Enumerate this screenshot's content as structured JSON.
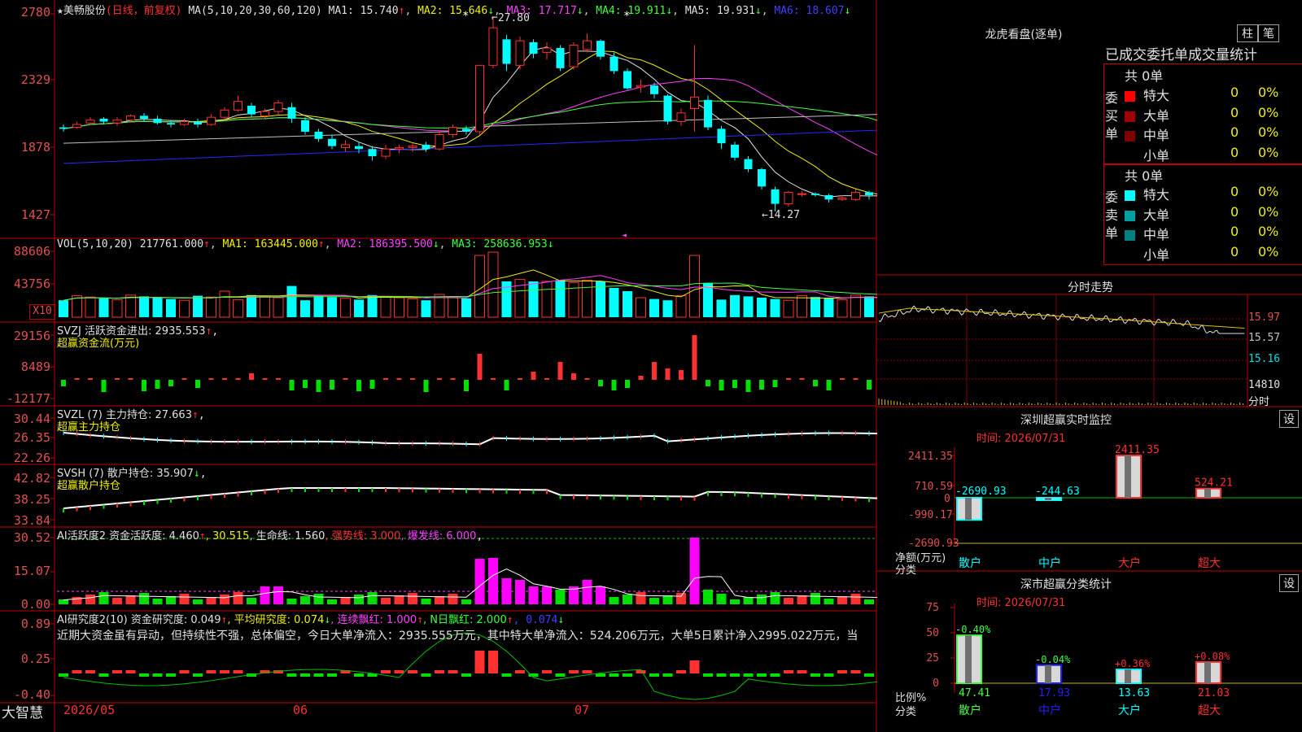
{
  "colors": {
    "up": "#ff3030",
    "down": "#00ffff",
    "ma1": "#e0e0e0",
    "ma2": "#f0f000",
    "ma3": "#ff40ff",
    "ma4": "#40ff40",
    "ma5": "#c0c0c0",
    "ma6": "#2828ff",
    "grid": "#c00000"
  },
  "main": {
    "stock": "★美畅股份",
    "mode": "(日线，前复权)",
    "ma_label": "MA(5,10,20,30,60,120)",
    "ma1": "MA1: 15.740",
    "ma2": "MA2: 15.646",
    "ma3": "MA3: 17.717",
    "ma4": "MA4: 19.911",
    "ma5": "MA5: 19.931",
    "ma6": "MA6: 18.607",
    "ma1_arrow": "↑",
    "ma2_arrow": "↓",
    "ma3_arrow": "↓",
    "ma4_arrow": "↓",
    "ma5_arrow": "↓",
    "ma6_arrow": "↓",
    "ylabels": [
      "2780",
      "2329",
      "1878",
      "1427"
    ],
    "high_label": "27.80",
    "low_label": "←14.27"
  },
  "vol": {
    "label": "VOL(5,10,20)",
    "v": "217761.000",
    "ma1": "MA1: 163445.000",
    "ma2": "MA2: 186395.500",
    "ma3": "MA3: 258636.953",
    "v_arrow": "↑",
    "ma1_arrow": "↑",
    "ma2_arrow": "↓",
    "ma3_arrow": "↓",
    "ylabels": [
      "88606",
      "43756"
    ],
    "unit": "X10"
  },
  "svzj": {
    "label": "SVZJ  活跃资金进出: 2935.553",
    "arrow": "↑",
    "tail": ",",
    "sub": "超赢资金流(万元)",
    "ylabels": [
      "29156",
      "8489",
      "-12177"
    ]
  },
  "svzl": {
    "label": "SVZL (7) 主力持仓: 27.663",
    "arrow": "↑",
    "tail": ",",
    "sub": "超赢主力持仓",
    "ylabels": [
      "30.44",
      "26.35",
      "22.26"
    ]
  },
  "svsh": {
    "label": "SVSH (7) 散户持仓: 35.907",
    "arrow": "↓",
    "tail": ",",
    "sub": "超赢散户持仓",
    "ylabels": [
      "42.82",
      "38.25",
      "33.84"
    ]
  },
  "ai1": {
    "label": "AI活跃度2 资金活跃度: 4.460",
    "a1": "↑",
    "v2": ", 30.515",
    "v3": ", 生命线: 1.560",
    "v4": ", 强势线: 3.000",
    "v5": ", 爆发线: 6.000",
    "tail": ",",
    "ylabels": [
      "30.52",
      "15.07",
      "0.00"
    ]
  },
  "ai2": {
    "label": "AI研究度2(10) 资金研究度: 0.049",
    "a1": "↑",
    "v2": ", 平均研究度: 0.074",
    "a2": "↓",
    "v3": ", 连续飘红: 1.000",
    "a3": "↑",
    "v4": ", N日飘红: 2.000",
    "a4": "↑",
    "v5": ", 0.074",
    "a5": "↓",
    "text": "近期大资金虽有异动，但持续性不强，总体偏空，今日大单净流入：2935.555万元，其中特大单净流入：524.206万元，大单5日累计净入2995.022万元，当",
    "ylabels": [
      "0.89",
      "0.25",
      "-0.40"
    ]
  },
  "xaxis": {
    "brand": "大智慧",
    "d1": "2026/05",
    "d2": "06",
    "d3": "07"
  },
  "lhb": {
    "title": "龙虎看盘(逐单)",
    "btn1": "柱",
    "btn2": "笔",
    "head": "已成交委托单成交量统计",
    "buy_side": "委买单",
    "sell_side": "委卖单",
    "buy_total": "共 0单",
    "sell_total": "共 0单",
    "buy_rows": [
      {
        "name": "特大",
        "v": "0",
        "p": "0%"
      },
      {
        "name": "大单",
        "v": "0",
        "p": "0%"
      },
      {
        "name": "中单",
        "v": "0",
        "p": "0%"
      },
      {
        "name": "小单",
        "v": "0",
        "p": "0%"
      }
    ],
    "sell_rows": [
      {
        "name": "特大",
        "v": "0",
        "p": "0%"
      },
      {
        "name": "大单",
        "v": "0",
        "p": "0%"
      },
      {
        "name": "中单",
        "v": "0",
        "p": "0%"
      },
      {
        "name": "小单",
        "v": "0",
        "p": "0%"
      }
    ]
  },
  "fs": {
    "title": "分时走势",
    "p1": "15.97",
    "p2": "15.57",
    "p3": "15.16",
    "vol": "14810",
    "unit": "分时"
  },
  "sz": {
    "title": "深圳超赢实时监控",
    "btn": "设",
    "time": "时间: 2026/07/31",
    "ylabels": [
      "2411.35",
      "710.59",
      "0",
      "-990.17",
      "-2690.93"
    ],
    "ylab": "净额(万元)",
    "xlab": "分类",
    "bars": [
      {
        "name": "散户",
        "value": -2690.93,
        "label": "-2690.93"
      },
      {
        "name": "中户",
        "value": -244.63,
        "label": "-244.63"
      },
      {
        "name": "大户",
        "value": 2411.35,
        "label": "2411.35"
      },
      {
        "name": "超大",
        "value": 524.21,
        "label": "524.21"
      }
    ]
  },
  "ss": {
    "title": "深市超赢分类统计",
    "btn": "设",
    "time": "时间: 2026/07/31",
    "ylabels": [
      "75",
      "50",
      "25",
      "0"
    ],
    "ylab": "比例%",
    "xlab": "分类",
    "bars": [
      {
        "name": "散户",
        "value": 47.41,
        "label": "47.41",
        "delta": "-0.40%"
      },
      {
        "name": "中户",
        "value": 17.93,
        "label": "17.93",
        "delta": "-0.04%"
      },
      {
        "name": "大户",
        "value": 13.63,
        "label": "13.63",
        "delta": "+0.36%"
      },
      {
        "name": "超大",
        "value": 21.03,
        "label": "21.03",
        "delta": "+0.08%"
      }
    ]
  },
  "chart_data": {
    "type": "candlestick",
    "title": "美畅股份 日线 前复权",
    "candles": [
      [
        20.1,
        20.0,
        20.3,
        19.8
      ],
      [
        20.1,
        20.3,
        20.5,
        20.0
      ],
      [
        20.4,
        20.6,
        20.8,
        20.3
      ],
      [
        20.7,
        20.5,
        20.8,
        20.3
      ],
      [
        20.4,
        20.6,
        20.8,
        20.2
      ],
      [
        20.6,
        20.9,
        21.0,
        20.5
      ],
      [
        20.9,
        20.7,
        21.1,
        20.5
      ],
      [
        20.7,
        20.4,
        20.9,
        20.3
      ],
      [
        20.4,
        20.3,
        20.6,
        20.1
      ],
      [
        20.3,
        20.5,
        20.7,
        20.2
      ],
      [
        20.5,
        20.3,
        20.7,
        20.1
      ],
      [
        20.3,
        20.8,
        21.0,
        20.2
      ],
      [
        20.8,
        21.3,
        21.5,
        20.7
      ],
      [
        21.3,
        21.9,
        22.3,
        21.2
      ],
      [
        21.6,
        21.0,
        21.8,
        20.8
      ],
      [
        20.9,
        21.2,
        21.4,
        20.7
      ],
      [
        21.2,
        21.8,
        22.0,
        21.0
      ],
      [
        21.5,
        20.7,
        21.8,
        20.4
      ],
      [
        20.6,
        19.8,
        20.8,
        19.6
      ],
      [
        19.8,
        19.3,
        20.0,
        19.1
      ],
      [
        19.3,
        18.8,
        19.6,
        18.6
      ],
      [
        18.7,
        18.9,
        19.2,
        18.4
      ],
      [
        18.8,
        18.6,
        19.1,
        18.3
      ],
      [
        18.6,
        18.1,
        18.8,
        17.8
      ],
      [
        18.1,
        18.6,
        18.9,
        17.9
      ],
      [
        18.6,
        18.7,
        18.9,
        18.3
      ],
      [
        18.7,
        18.8,
        19.0,
        18.4
      ],
      [
        18.9,
        18.6,
        19.1,
        18.4
      ],
      [
        18.6,
        19.6,
        19.9,
        18.5
      ],
      [
        19.6,
        20.1,
        20.3,
        19.4
      ],
      [
        20.0,
        19.8,
        20.2,
        19.6
      ],
      [
        19.8,
        24.4,
        24.4,
        19.6
      ],
      [
        24.4,
        27.0,
        27.8,
        24.2
      ],
      [
        26.2,
        24.5,
        26.5,
        24.0
      ],
      [
        24.4,
        26.1,
        26.4,
        24.1
      ],
      [
        26.0,
        25.2,
        26.2,
        24.9
      ],
      [
        25.3,
        25.6,
        26.0,
        24.8
      ],
      [
        25.6,
        24.2,
        25.8,
        24.0
      ],
      [
        24.3,
        25.8,
        26.0,
        24.1
      ],
      [
        25.5,
        26.1,
        26.6,
        25.3
      ],
      [
        26.1,
        25.0,
        26.2,
        24.8
      ],
      [
        25.0,
        24.0,
        25.3,
        23.8
      ],
      [
        24.0,
        22.8,
        24.2,
        22.7
      ],
      [
        22.9,
        23.0,
        23.4,
        22.5
      ],
      [
        23.0,
        22.4,
        23.2,
        22.1
      ],
      [
        22.3,
        20.5,
        22.4,
        20.3
      ],
      [
        20.5,
        21.1,
        21.4,
        20.2
      ],
      [
        21.4,
        22.2,
        25.8,
        19.8
      ],
      [
        22.0,
        20.1,
        22.3,
        19.9
      ],
      [
        20.0,
        19.0,
        20.2,
        18.6
      ],
      [
        18.9,
        18.0,
        19.1,
        17.8
      ],
      [
        17.9,
        17.2,
        18.1,
        17.0
      ],
      [
        17.2,
        16.0,
        17.3,
        15.8
      ],
      [
        15.8,
        14.8,
        16.0,
        14.27
      ],
      [
        14.8,
        15.6,
        15.7,
        14.6
      ],
      [
        15.5,
        15.5,
        15.7,
        15.3
      ],
      [
        15.5,
        15.4,
        15.6,
        15.3
      ],
      [
        15.4,
        15.1,
        15.5,
        14.9
      ],
      [
        15.1,
        15.2,
        15.4,
        15.0
      ],
      [
        15.1,
        15.6,
        15.8,
        15.0
      ],
      [
        15.6,
        15.4,
        15.7,
        15.1
      ],
      [
        15.4,
        15.5,
        15.6,
        15.2
      ],
      [
        15.4,
        15.3,
        15.6,
        15.1
      ],
      [
        15.4,
        15.7,
        16.1,
        15.3
      ]
    ],
    "price_high": 27.8,
    "price_low": 14.27
  }
}
